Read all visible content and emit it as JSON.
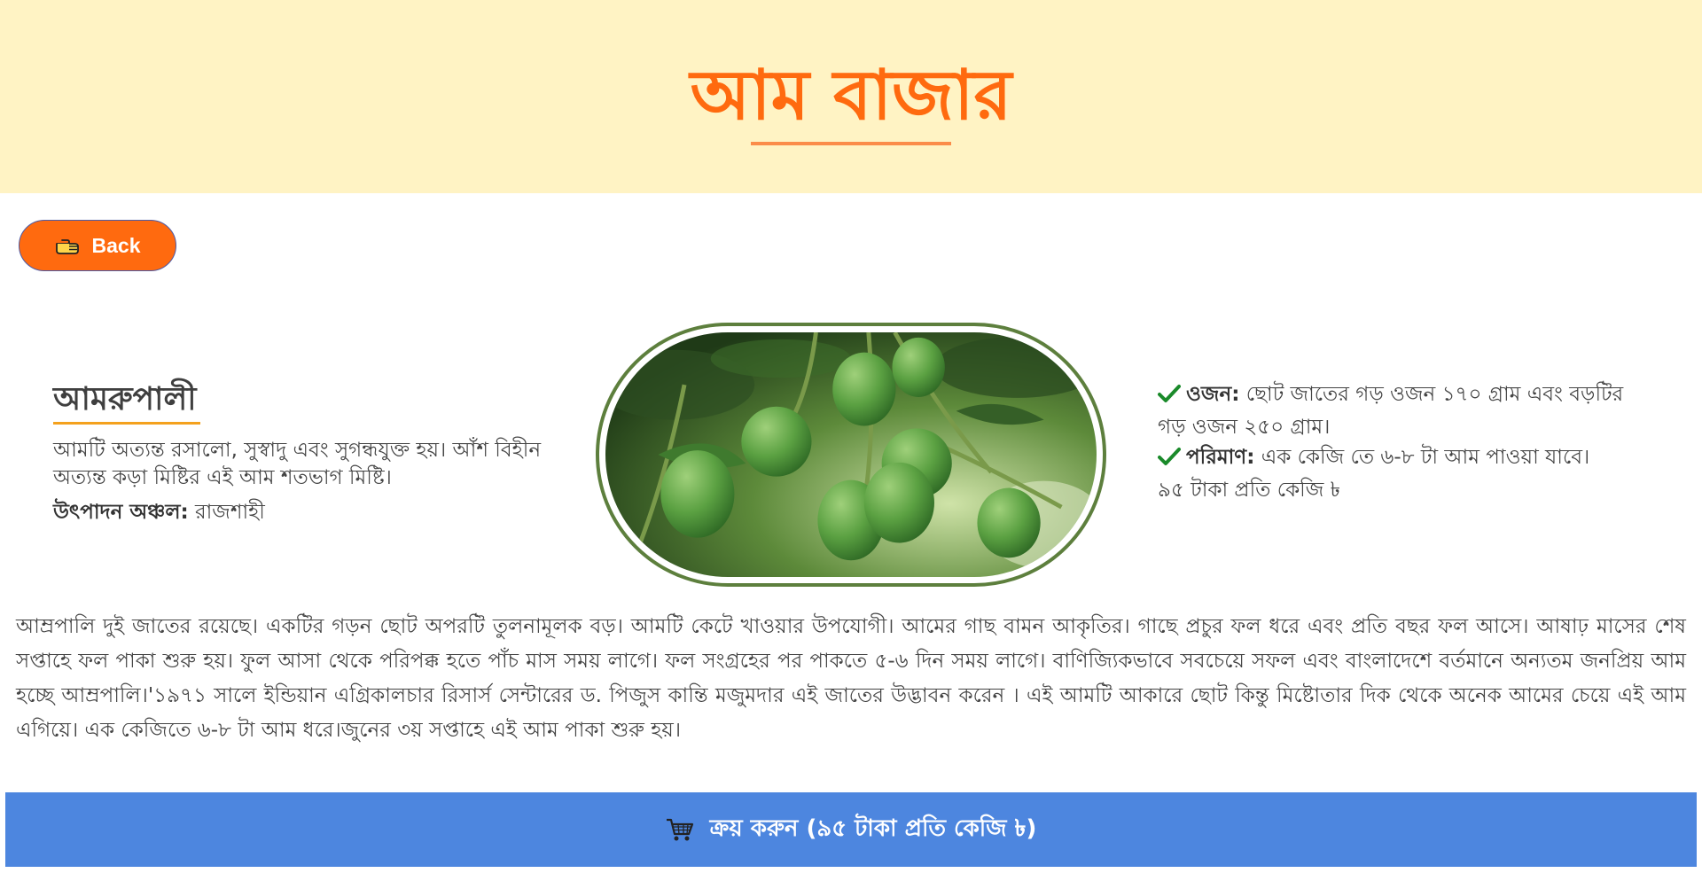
{
  "header": {
    "title": "আম বাজার"
  },
  "back_button": {
    "label": "Back",
    "icon": "pointing-hand-icon"
  },
  "product": {
    "name": "আমরুপালী",
    "short_description": "আমটি অত্যন্ত রসালো, সুস্বাদু এবং সুগন্ধযুক্ত হয়। আঁশ বিহীন অত্যন্ত কড়া মিষ্টির এই আম শতভাগ মিষ্টি।",
    "origin_label": "উৎপাদন অঞ্চল:",
    "origin_value": "রাজশাহী",
    "image_icon": "mango-photo"
  },
  "specs": {
    "weight_label": "ওজন:",
    "weight_value": "ছোট জাতের গড় ওজন ১৭০ গ্রাম এবং বড়টির গড় ওজন ২৫০ গ্রাম।",
    "quantity_label": "পরিমাণ:",
    "quantity_value": "এক কেজি তে ৬-৮ টা আম পাওয়া যাবে।",
    "price_text": "৯৫ টাকা প্রতি কেজি ৳",
    "check_icon": "checkmark-icon"
  },
  "description": "আম্রপালি দুই জাতের রয়েছে। একটির গড়ন ছোট অপরটি তুলনামূলক বড়। আমটি কেটে খাওয়ার উপযোগী। আমের গাছ বামন আকৃতির। গাছে প্রচুর ফল ধরে এবং প্রতি বছর ফল আসে। আষাঢ় মাসের শেষ সপ্তাহে ফল পাকা শুরু হয়। ফুল আসা থেকে পরিপক্ক হতে পাঁচ মাস সময় লাগে। ফল সংগ্রহের পর পাকতে ৫-৬ দিন সময় লাগে। বাণিজ্যিকভাবে সবচেয়ে সফল এবং বাংলাদেশে বর্তমানে অন্যতম জনপ্রিয় আম হচ্ছে আম্রপালি।'১৯৭১ সালে ইন্ডিয়ান এগ্রিকালচার রিসার্স সেন্টারের ড. পিজুস কান্তি মজুমদার এই জাতের উদ্ভাবন করেন । এই আমটি আকারে ছোট কিন্তু মিষ্টোতার দিক থেকে অনেক আমের চেয়ে এই আম এগিয়ে। এক কেজিতে ৬-৮ টা আম ধরে।জুনের ৩য় সপ্তাহে এই আম পাকা শুরু হয়।",
  "buy_button": {
    "label": "ক্রয় করুন (৯৫ টাকা প্রতি কেজি ৳)",
    "icon": "shopping-cart-icon"
  },
  "colors": {
    "header_bg": "#fff3c4",
    "accent_orange": "#ff6a0f",
    "buy_blue": "#4d86df",
    "frame_green": "#5d7f3d",
    "underline_gold": "#f4a11d"
  }
}
